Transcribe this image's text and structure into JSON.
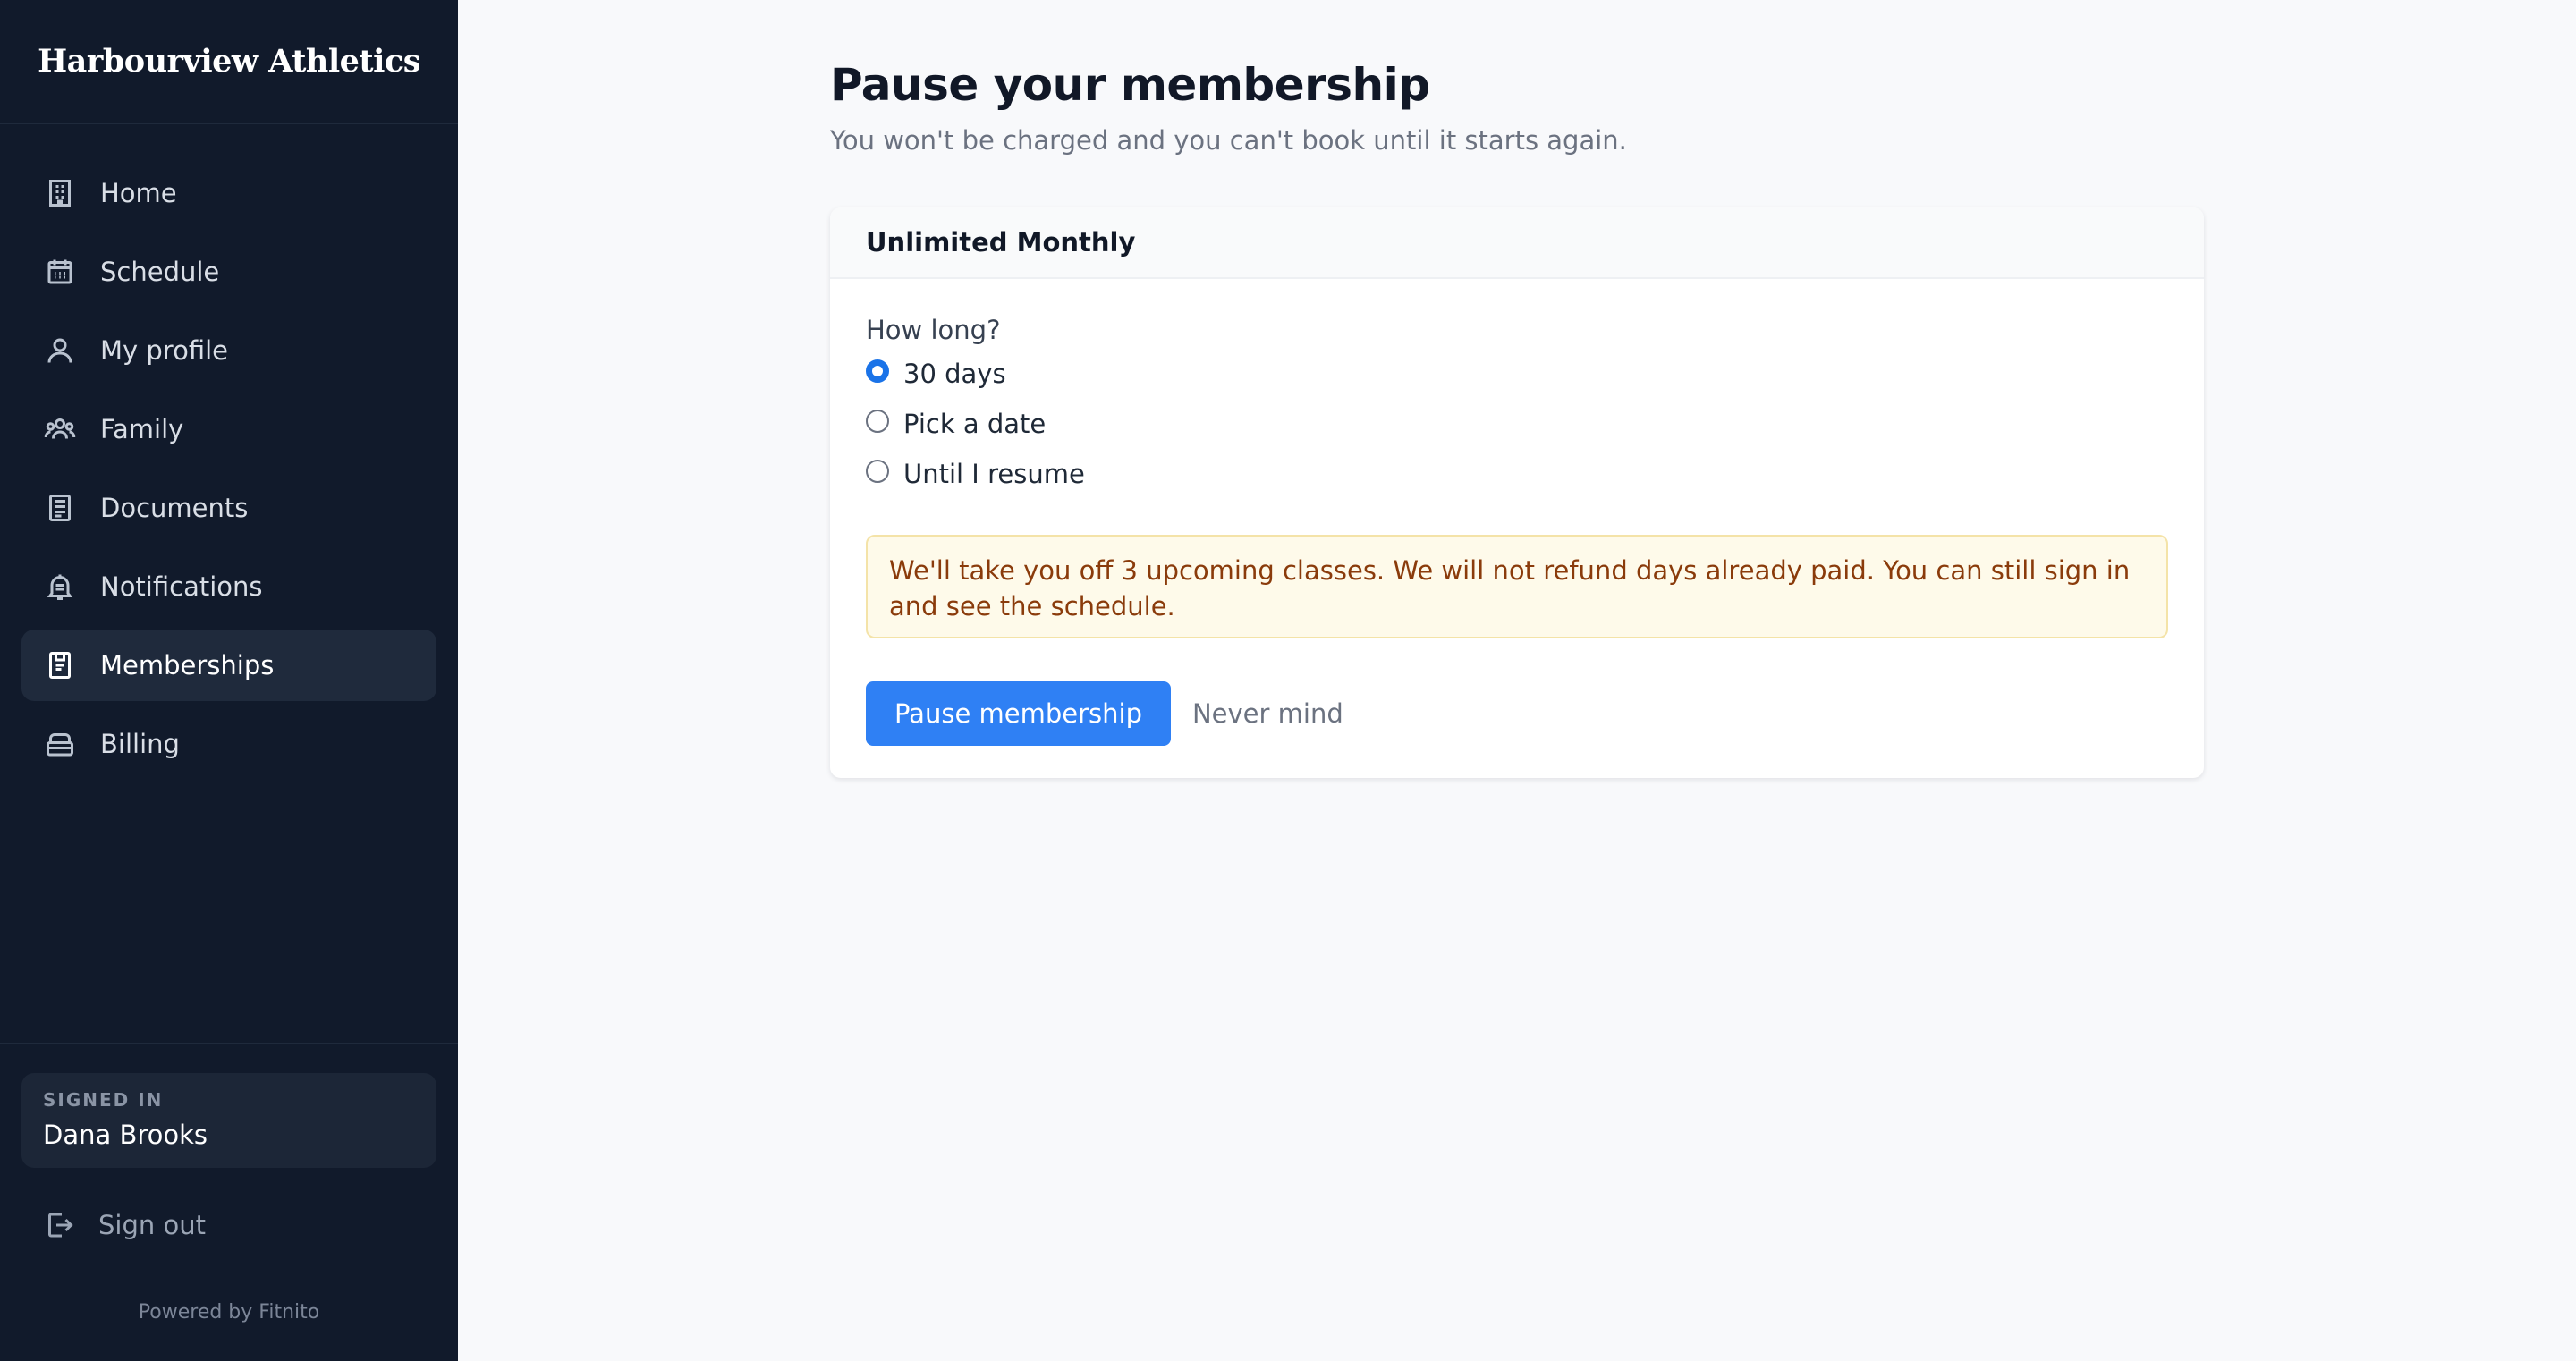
{
  "brand": "Harbourview Athletics",
  "nav": {
    "items": [
      {
        "label": "Home",
        "icon": "building-icon"
      },
      {
        "label": "Schedule",
        "icon": "calendar-icon"
      },
      {
        "label": "My profile",
        "icon": "user-icon"
      },
      {
        "label": "Family",
        "icon": "users-icon"
      },
      {
        "label": "Documents",
        "icon": "document-icon"
      },
      {
        "label": "Notifications",
        "icon": "bell-icon"
      },
      {
        "label": "Memberships",
        "icon": "clipboard-icon",
        "active": true
      },
      {
        "label": "Billing",
        "icon": "wallet-icon"
      }
    ]
  },
  "account": {
    "signed_in_label": "SIGNED IN",
    "name": "Dana Brooks",
    "signout_label": "Sign out"
  },
  "footer": {
    "powered": "Powered by Fitnito"
  },
  "page": {
    "title": "Pause your membership",
    "subtitle": "You won't be charged and you can't book until it starts again."
  },
  "card": {
    "header": "Unlimited Monthly",
    "question": "How long?",
    "options": [
      {
        "label": "30 days",
        "checked": true
      },
      {
        "label": "Pick a date",
        "checked": false
      },
      {
        "label": "Until I resume",
        "checked": false
      }
    ],
    "notice": "We'll take you off 3 upcoming classes. We will not refund days already paid. You can still sign in and see the schedule.",
    "primary_button": "Pause membership",
    "secondary_button": "Never mind"
  },
  "colors": {
    "sidebar_bg": "#111a2b",
    "primary": "#2f80f4",
    "notice_bg": "#fefaea",
    "notice_text": "#8a3b0b"
  }
}
